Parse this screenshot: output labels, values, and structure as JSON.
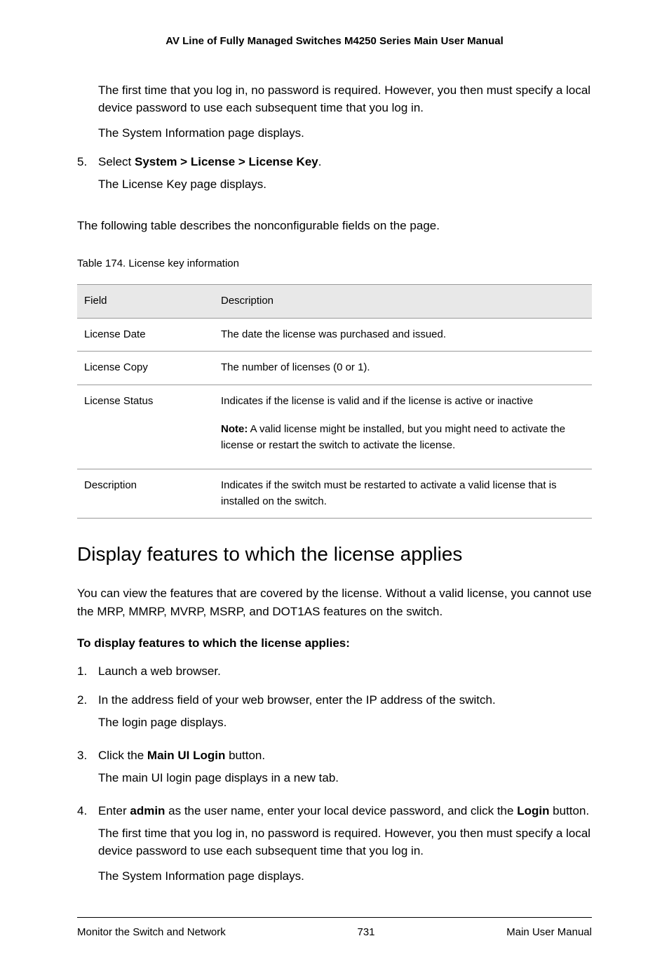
{
  "header": {
    "title": "AV Line of Fully Managed Switches M4250 Series Main User Manual"
  },
  "preamble": {
    "p1": "The first time that you log in, no password is required. However, you then must specify a local device password to use each subsequent time that you log in.",
    "p2": "The System Information page displays."
  },
  "step5": {
    "num": "5.",
    "select_prefix": "Select ",
    "select_path": "System > License > License Key",
    "select_suffix": ".",
    "result": "The License Key page displays."
  },
  "intro": "The following table describes the nonconfigurable fields on the page.",
  "table": {
    "caption": "Table 174. License key information",
    "head_field": "Field",
    "head_desc": "Description",
    "rows": [
      {
        "field": "License Date",
        "desc": "The date the license was purchased and issued."
      },
      {
        "field": "License Copy",
        "desc": "The number of licenses (0 or 1)."
      },
      {
        "field": "License Status",
        "desc": "Indicates if the license is valid and if the license is active or inactive",
        "note_label": "Note:",
        "note_text": "  A valid license might be installed, but you might need to activate the license or restart the switch to activate the license."
      },
      {
        "field": "Description",
        "desc": "Indicates if the switch must be restarted to activate a valid license that is installed on the switch."
      }
    ]
  },
  "section": {
    "heading": "Display features to which the license applies",
    "intro": "You can view the features that are covered by the license. Without a valid license, you cannot use the MRP, MMRP, MVRP, MSRP, and DOT1AS features on the switch.",
    "proc_title": "To display features to which the license applies:",
    "steps": {
      "s1": {
        "num": "1.",
        "text": "Launch a web browser."
      },
      "s2": {
        "num": "2.",
        "text": "In the address field of your web browser, enter the IP address of the switch.",
        "result": "The login page displays."
      },
      "s3": {
        "num": "3.",
        "prefix": "Click the ",
        "bold": "Main UI Login",
        "suffix": " button.",
        "result": "The main UI login page displays in a new tab."
      },
      "s4": {
        "num": "4.",
        "prefix": "Enter ",
        "bold1": "admin",
        "mid": " as the user name, enter your local device password, and click the ",
        "bold2": "Login",
        "suffix": " button.",
        "p2": "The first time that you log in, no password is required. However, you then must specify a local device password to use each subsequent time that you log in.",
        "p3": "The System Information page displays."
      }
    }
  },
  "footer": {
    "left": "Monitor the Switch and Network",
    "center": "731",
    "right": "Main User Manual"
  }
}
